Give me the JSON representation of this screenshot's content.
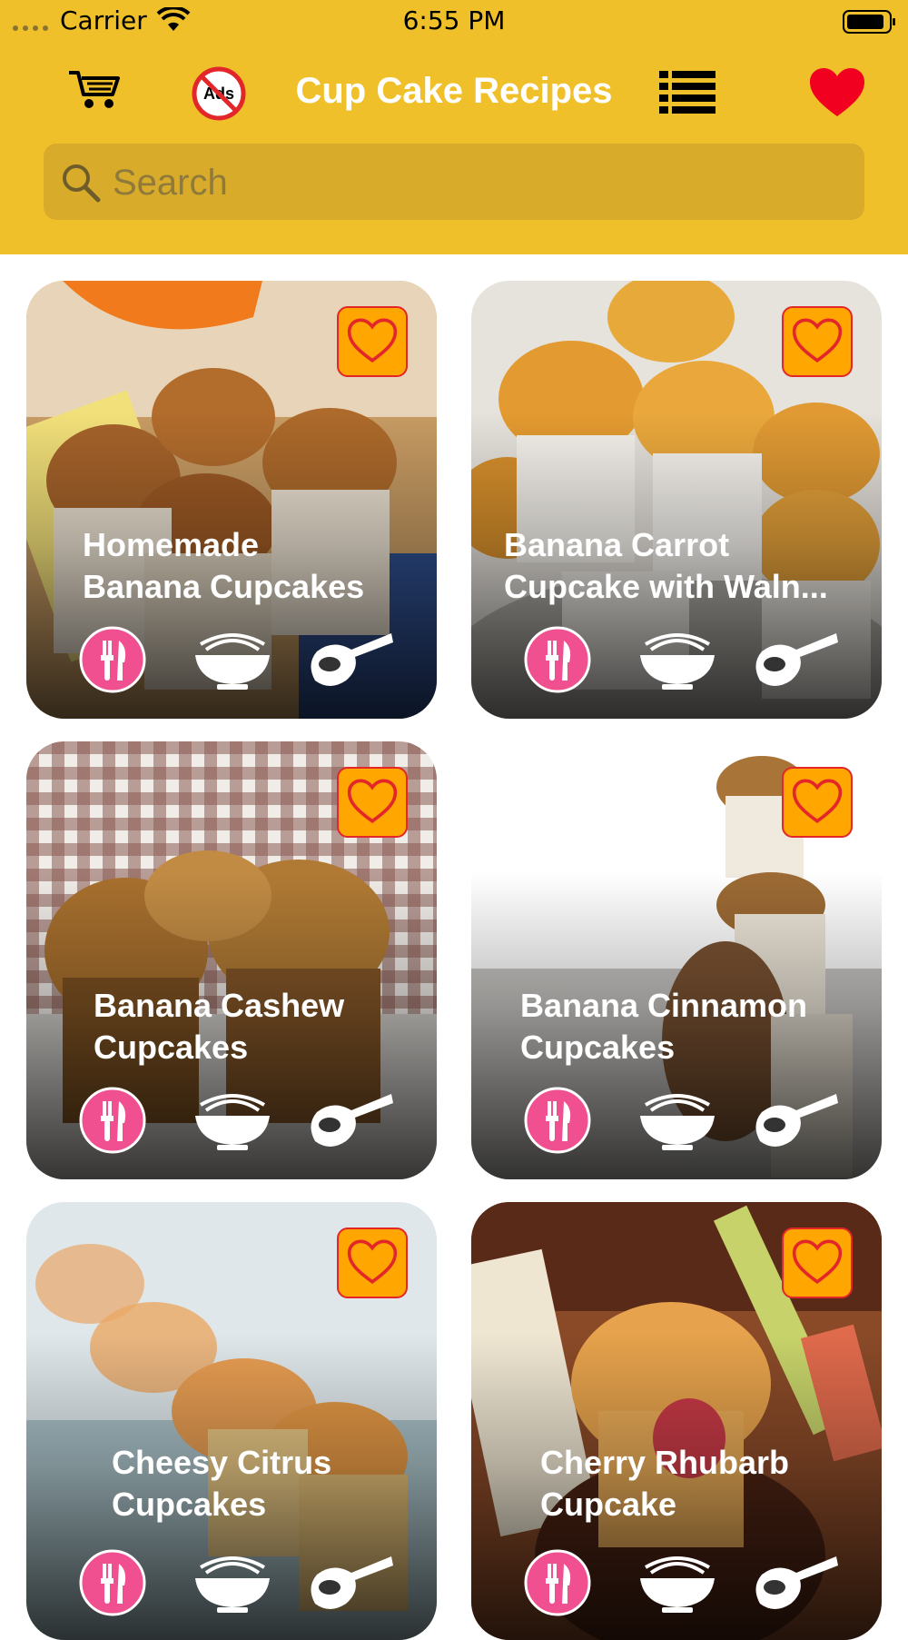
{
  "status_bar": {
    "carrier": "Carrier",
    "time": "6:55 PM"
  },
  "header": {
    "title": "Cup Cake Recipes",
    "icons": [
      "cart-icon",
      "no-ads-icon",
      "list-icon",
      "heart-icon"
    ]
  },
  "search": {
    "placeholder": "Search",
    "value": ""
  },
  "colors": {
    "header_bg": "#efc02a",
    "search_bg": "#d8ac2a",
    "favorite_badge": "#ffa600",
    "favorite_heart": "#e2262a",
    "recipe_icon": "#f0508f"
  },
  "recipes": [
    {
      "title_line1": "Homemade",
      "title_line2": "Banana Cupcakes"
    },
    {
      "title_line1": "Banana Carrot",
      "title_line2": "Cupcake with Waln..."
    },
    {
      "title_line1": "Banana Cashew",
      "title_line2": "Cupcakes"
    },
    {
      "title_line1": "Banana Cinnamon",
      "title_line2": "Cupcakes"
    },
    {
      "title_line1": "Cheesy Citrus",
      "title_line2": "Cupcakes"
    },
    {
      "title_line1": "Cherry Rhubarb",
      "title_line2": "Cupcake"
    }
  ]
}
